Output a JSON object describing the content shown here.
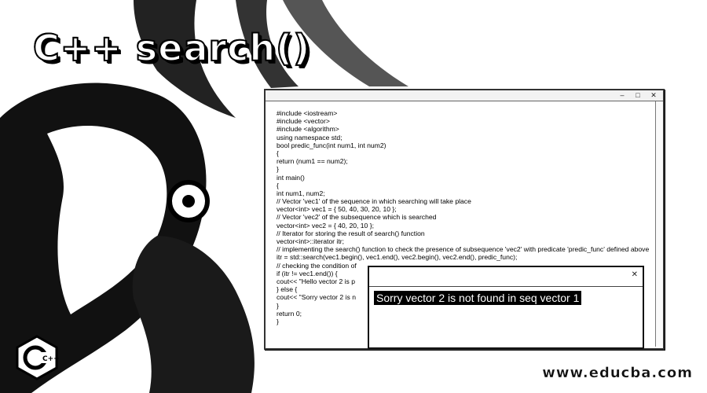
{
  "title": "C++ search()",
  "window": {
    "buttons": [
      "–",
      "□",
      "✕"
    ],
    "code_lines": [
      "#include <iostream>",
      "#include <vector>",
      "#include <algorithm>",
      "using namespace std;",
      "bool predic_func(int num1, int num2)",
      "{",
      "return (num1 == num2);",
      "}",
      "int main()",
      "{",
      "int num1, num2;",
      "// Vector 'vec1' of the sequence in which searching will take place",
      "vector<int> vec1 = { 50, 40, 30, 20, 10 };",
      "// Vector 'vec2' of the subsequence which is searched",
      "vector<int> vec2 = { 40, 20, 10 };",
      "// Iterator for storing the result of search() function",
      "vector<int>::iterator itr;",
      "// implementing the search() function to check the presence of subsequence 'vec2' with predicate 'predic_func' defined above",
      "itr = std::search(vec1.begin(), vec1.end(), vec2.begin(), vec2.end(), predic_func);",
      "// checking the condition of",
      "if (itr != vec1.end()) {",
      "cout<< \"Hello vector 2 is p",
      "} else {",
      "cout<< \"Sorry vector 2 is n",
      "}",
      "return 0;",
      "}"
    ]
  },
  "output": {
    "close_glyph": "✕",
    "text": "Sorry vector 2 is not found in seq vector 1"
  },
  "watermark": "www.educba.com",
  "logo_text": "C++"
}
